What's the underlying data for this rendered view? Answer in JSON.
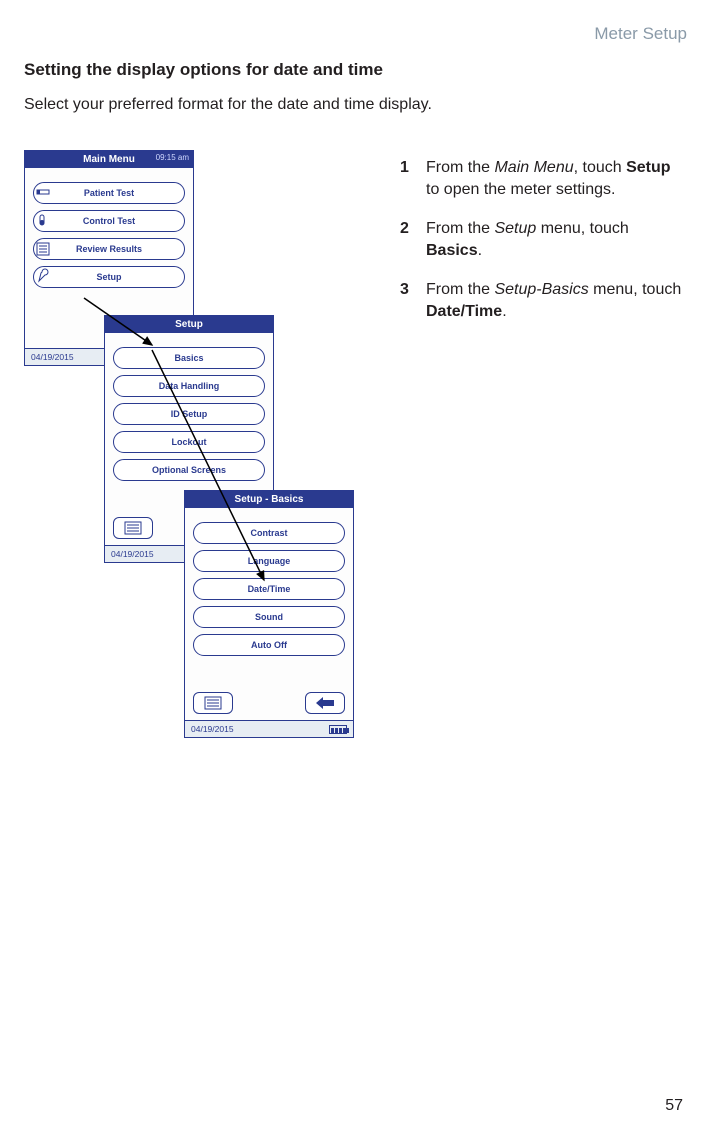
{
  "header": {
    "section": "Meter Setup"
  },
  "title": "Setting the display options for date and time",
  "intro": "Select your preferred format for the date and time display.",
  "steps": [
    {
      "n": "1",
      "pre": "From the ",
      "i1": "Main Menu",
      "mid": ", touch ",
      "b1": "Setup",
      "post": " to open the meter settings."
    },
    {
      "n": "2",
      "pre": "From the ",
      "i1": "Setup",
      "mid": " menu, touch ",
      "b1": "Basics",
      "post": "."
    },
    {
      "n": "3",
      "pre": "From the ",
      "i1": "Setup-Basics",
      "mid": " menu, touch ",
      "b1": "Date/Time",
      "post": "."
    }
  ],
  "page_num": "57",
  "screen1": {
    "title": "Main Menu",
    "time": "09:15 am",
    "items": [
      "Patient Test",
      "Control Test",
      "Review Results",
      "Setup"
    ],
    "date": "04/19/2015"
  },
  "screen2": {
    "title": "Setup",
    "items": [
      "Basics",
      "Data Handling",
      "ID Setup",
      "Lockout",
      "Optional Screens"
    ],
    "date": "04/19/2015"
  },
  "screen3": {
    "title": "Setup - Basics",
    "items": [
      "Contrast",
      "Language",
      "Date/Time",
      "Sound",
      "Auto Off"
    ],
    "date": "04/19/2015"
  }
}
